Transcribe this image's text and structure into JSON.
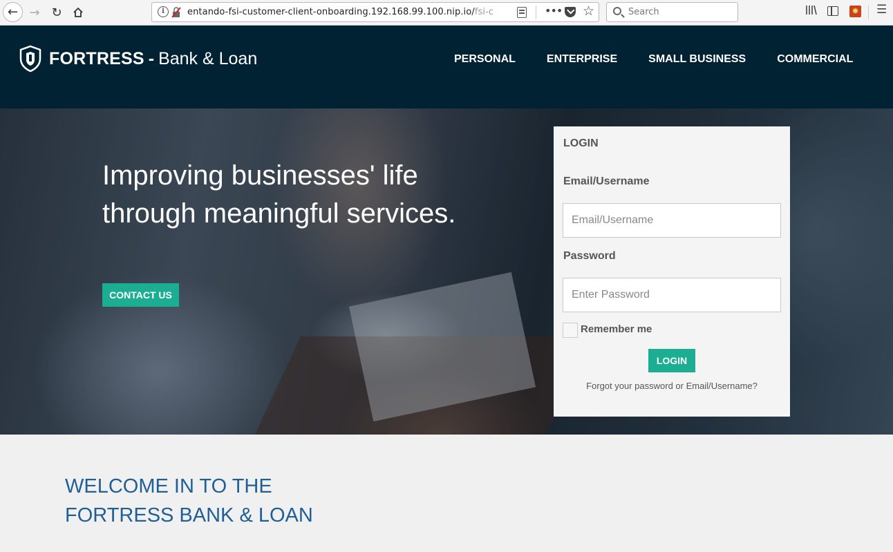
{
  "browser": {
    "url_main": "entando-fsi-customer-client-onboarding.192.168.99.100.nip.io/",
    "url_faded": "fsi-c",
    "search_placeholder": "Search",
    "icons": [
      "back-icon",
      "forward-icon",
      "reload-icon",
      "home-icon",
      "info-icon",
      "insecure-lock-icon",
      "reader-view-icon",
      "more-icon",
      "pocket-icon",
      "bookmark-star-icon",
      "search-icon",
      "library-icon",
      "sidebar-icon",
      "extension-icon",
      "menu-icon"
    ]
  },
  "header": {
    "brand": "FORTRESS",
    "dash": "-",
    "brand_sub": "Bank & Loan",
    "nav": [
      "PERSONAL",
      "ENTERPRISE",
      "SMALL BUSINESS",
      "COMMERCIAL"
    ],
    "background_color": "#012233"
  },
  "hero": {
    "title": "Improving businesses' life through meaningful services.",
    "contact_label": "CONTACT US",
    "accent_color": "#1cae92"
  },
  "login": {
    "heading": "LOGIN",
    "email_label": "Email/Username",
    "email_placeholder": "Email/Username",
    "password_label": "Password",
    "password_placeholder": "Enter Password",
    "remember_label": "Remember me",
    "remember_checked": false,
    "submit_label": "LOGIN",
    "forgot_label": "Forgot your password or Email/Username?"
  },
  "welcome": {
    "line1": "WELCOME IN TO THE",
    "line2": "FORTRESS BANK & LOAN",
    "title_color": "#1f5f95"
  }
}
